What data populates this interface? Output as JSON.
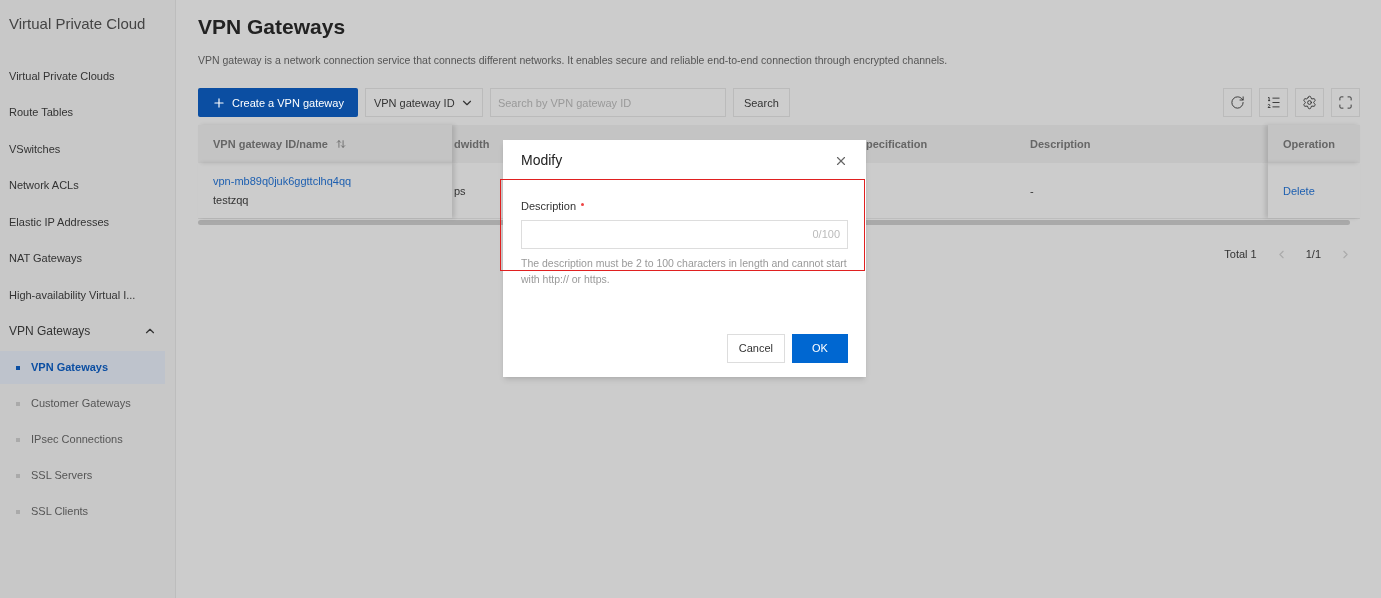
{
  "sidebar": {
    "title": "Virtual Private Cloud",
    "items": [
      {
        "label": "Virtual Private Clouds",
        "selected": false
      },
      {
        "label": "Route Tables",
        "selected": false
      },
      {
        "label": "VSwitches",
        "selected": false
      },
      {
        "label": "Network ACLs",
        "selected": false
      },
      {
        "label": "Elastic IP Addresses",
        "selected": false
      },
      {
        "label": "NAT Gateways",
        "selected": false
      },
      {
        "label": "High-availability Virtual I...",
        "selected": false
      },
      {
        "label": "VPN Gateways",
        "expanded": true,
        "children": [
          {
            "label": "VPN Gateways",
            "selected": true
          },
          {
            "label": "Customer Gateways",
            "selected": false
          },
          {
            "label": "IPsec Connections",
            "selected": false
          },
          {
            "label": "SSL Servers",
            "selected": false
          },
          {
            "label": "SSL Clients",
            "selected": false
          }
        ]
      }
    ]
  },
  "page": {
    "title": "VPN Gateways",
    "description": "VPN gateway is a network connection service that connects different networks. It enables secure and reliable end-to-end connection through encrypted channels."
  },
  "toolbar": {
    "create_button": "Create a VPN gateway",
    "filter_select": "VPN gateway ID",
    "search_placeholder": "Search by VPN gateway ID",
    "search_button": "Search"
  },
  "table": {
    "columns": [
      "VPN gateway ID/name",
      "dwidth",
      "pecification",
      "Description",
      "Operation"
    ],
    "rows": [
      {
        "id": "vpn-mb89q0juk6ggttclhq4qq",
        "name": "testzqq",
        "column_2": "ps",
        "description": "-",
        "operation": "Delete"
      }
    ]
  },
  "pagination": {
    "total": "Total 1",
    "page": "1/1"
  },
  "dialog": {
    "title": "Modify",
    "field_label": "Description",
    "required": true,
    "counter": "0/100",
    "hint": "The description must be 2 to 100 characters in length and cannot start with http:// or https.",
    "cancel": "Cancel",
    "ok": "OK",
    "highlighted": true
  }
}
